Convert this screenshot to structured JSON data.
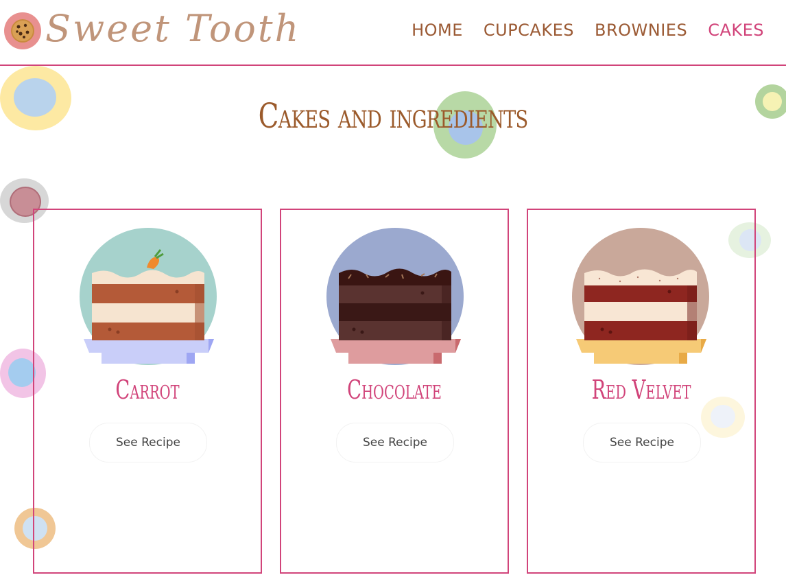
{
  "brand": {
    "name": "Sweet Tooth",
    "logo_icon": "cookie-icon"
  },
  "nav": [
    {
      "label": "HOME",
      "active": false
    },
    {
      "label": "CUPCAKES",
      "active": false
    },
    {
      "label": "BROWNIES",
      "active": false
    },
    {
      "label": "CAKES",
      "active": true
    }
  ],
  "page_title": "Cakes and ingredients",
  "cards": [
    {
      "name": "Carrot",
      "button": "See Recipe",
      "image_icon": "carrot-cake-icon"
    },
    {
      "name": "Chocolate",
      "button": "See Recipe",
      "image_icon": "chocolate-cake-icon"
    },
    {
      "name": "Red Velvet",
      "button": "See Recipe",
      "image_icon": "red-velvet-cake-icon"
    }
  ],
  "colors": {
    "accent": "#d1447a",
    "brown": "#9b5a34",
    "carrot_bg": "#a6d2cc",
    "chocolate_bg": "#9ba9cf",
    "redvelvet_bg": "#c9a89a"
  }
}
